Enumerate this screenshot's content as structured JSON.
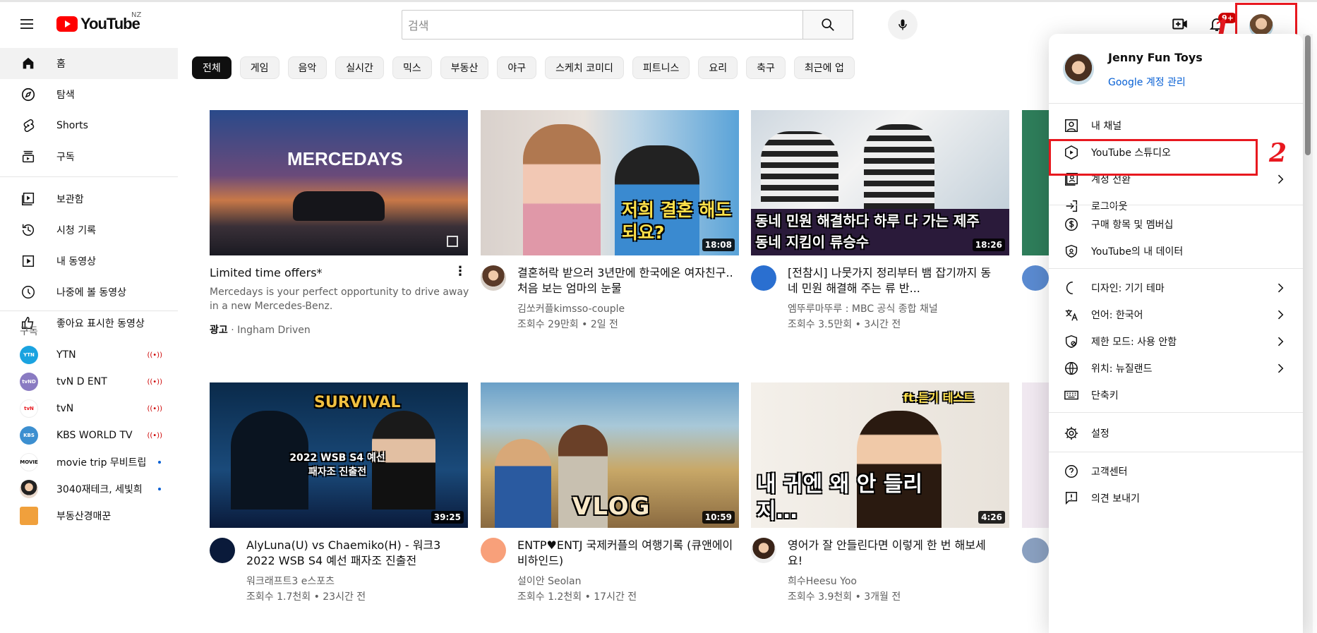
{
  "header": {
    "logo_text": "YouTube",
    "country": "NZ",
    "search_placeholder": "검색",
    "notification_badge": "9+"
  },
  "annotations": {
    "label1": "1",
    "label2": "2"
  },
  "sidebar": {
    "main": [
      {
        "label": "홈",
        "icon": "home-icon"
      },
      {
        "label": "탐색",
        "icon": "compass-icon"
      },
      {
        "label": "Shorts",
        "icon": "shorts-icon"
      },
      {
        "label": "구독",
        "icon": "subscriptions-icon"
      }
    ],
    "library": [
      {
        "label": "보관함",
        "icon": "library-icon"
      },
      {
        "label": "시청 기록",
        "icon": "history-icon"
      },
      {
        "label": "내 동영상",
        "icon": "my-videos-icon"
      },
      {
        "label": "나중에 볼 동영상",
        "icon": "watch-later-icon"
      },
      {
        "label": "좋아요 표시한 동영상",
        "icon": "liked-icon"
      }
    ],
    "subscriptions_header": "구독",
    "subscriptions": [
      {
        "name": "YTN",
        "avatar": "YTN",
        "color": "#1aa3e0",
        "status": "live"
      },
      {
        "name": "tvN D ENT",
        "avatar": "tvND",
        "color": "#8a7bc2",
        "status": "live"
      },
      {
        "name": "tvN",
        "avatar": "tvN",
        "color": "#ffffff",
        "status": "live"
      },
      {
        "name": "KBS WORLD TV",
        "avatar": "KBS",
        "color": "#3c8fd0",
        "status": "live"
      },
      {
        "name": "movie trip 무비트립",
        "avatar": "MOVIE",
        "color": "#ffffff",
        "status": "new"
      },
      {
        "name": "3040재테크, 세빛희",
        "avatar": "",
        "color": "#e8d8cc",
        "status": "new"
      },
      {
        "name": "부동산경매꾼",
        "avatar": "",
        "color": "#f0a03c",
        "status": ""
      }
    ]
  },
  "chips": [
    "전체",
    "게임",
    "음악",
    "실시간",
    "믹스",
    "부동산",
    "야구",
    "스케치 코미디",
    "피트니스",
    "요리",
    "축구",
    "최근에 업"
  ],
  "videos": [
    {
      "title": "Limited time offers*",
      "desc": "Mercedays is your perfect opportunity to drive away in a new Mercedes-Benz.",
      "ad_label": "광고",
      "channel": "Ingham Driven",
      "thumb_text": "MERCEDAYS",
      "duration": ""
    },
    {
      "title": "결혼허락 받으러 3년만에 한국에온 여자친구.. 처음 보는 엄마의 눈물",
      "channel": "김쏘커플kimsso-couple",
      "meta": "조회수 29만회 • 2일 전",
      "thumb_text": "저희 결혼 해도되요?",
      "duration": "18:08"
    },
    {
      "title": "[전참시] 나뭇가지 정리부터 뱀 잡기까지 동네 민원 해결해 주는 류 반...",
      "channel": "엠뚜루마뚜루 : MBC 공식 종합 채널",
      "meta": "조회수 3.5만회 • 3시간 전",
      "thumb_text": "동네 민원 해결하다 하루 다 가는 제주 동네 지킴이 류승수",
      "duration": "18:26"
    },
    {
      "title": "AlyLuna(U) vs Chaemiko(H) - 워크3 2022 WSB S4 예선 패자조 진출전",
      "channel": "워크래프트3 e스포츠",
      "meta": "조회수 1.7천회 • 23시간 전",
      "thumb_text": "2022 WSB S4 예선 패자조 진출전",
      "duration": "39:25"
    },
    {
      "title": "ENTP♥ENTJ 국제커플의 여행기록 (큐앤에이 비하인드)",
      "channel": "설이안 Seolan",
      "meta": "조회수 1.2천회 • 17시간 전",
      "thumb_text": "VLOG",
      "duration": "10:59"
    },
    {
      "title": "영어가 잘 안들린다면 이렇게 한 번 해보세요!",
      "channel": "희수Heesu Yoo",
      "meta": "조회수 3.9천회 • 3개월 전",
      "thumb_text": "내 귀엔 왜 안 들리지…",
      "duration": "4:26"
    }
  ],
  "account_menu": {
    "name": "Jenny Fun Toys",
    "manage": "Google 계정 관리",
    "items": [
      {
        "label": "내 채널",
        "icon": "person-icon",
        "chevron": false
      },
      {
        "label": "YouTube 스튜디오",
        "icon": "studio-icon",
        "chevron": false
      },
      {
        "label": "계정 전환",
        "icon": "switch-account-icon",
        "chevron": true
      },
      {
        "label": "로그아웃",
        "icon": "sign-out-icon",
        "chevron": false
      },
      {
        "label": "구매 항목 및 멤버십",
        "icon": "dollar-icon",
        "chevron": false
      },
      {
        "label": "YouTube의 내 데이터",
        "icon": "shield-icon",
        "chevron": false
      },
      {
        "label": "디자인: 기기 테마",
        "icon": "moon-icon",
        "chevron": true
      },
      {
        "label": "언어: 한국어",
        "icon": "translate-icon",
        "chevron": true
      },
      {
        "label": "제한 모드: 사용 안함",
        "icon": "restricted-icon",
        "chevron": true
      },
      {
        "label": "위치: 뉴질랜드",
        "icon": "globe-icon",
        "chevron": true
      },
      {
        "label": "단축키",
        "icon": "keyboard-icon",
        "chevron": false
      },
      {
        "label": "설정",
        "icon": "gear-icon",
        "chevron": false
      },
      {
        "label": "고객센터",
        "icon": "help-icon",
        "chevron": false
      },
      {
        "label": "의견 보내기",
        "icon": "feedback-icon",
        "chevron": false
      }
    ]
  }
}
